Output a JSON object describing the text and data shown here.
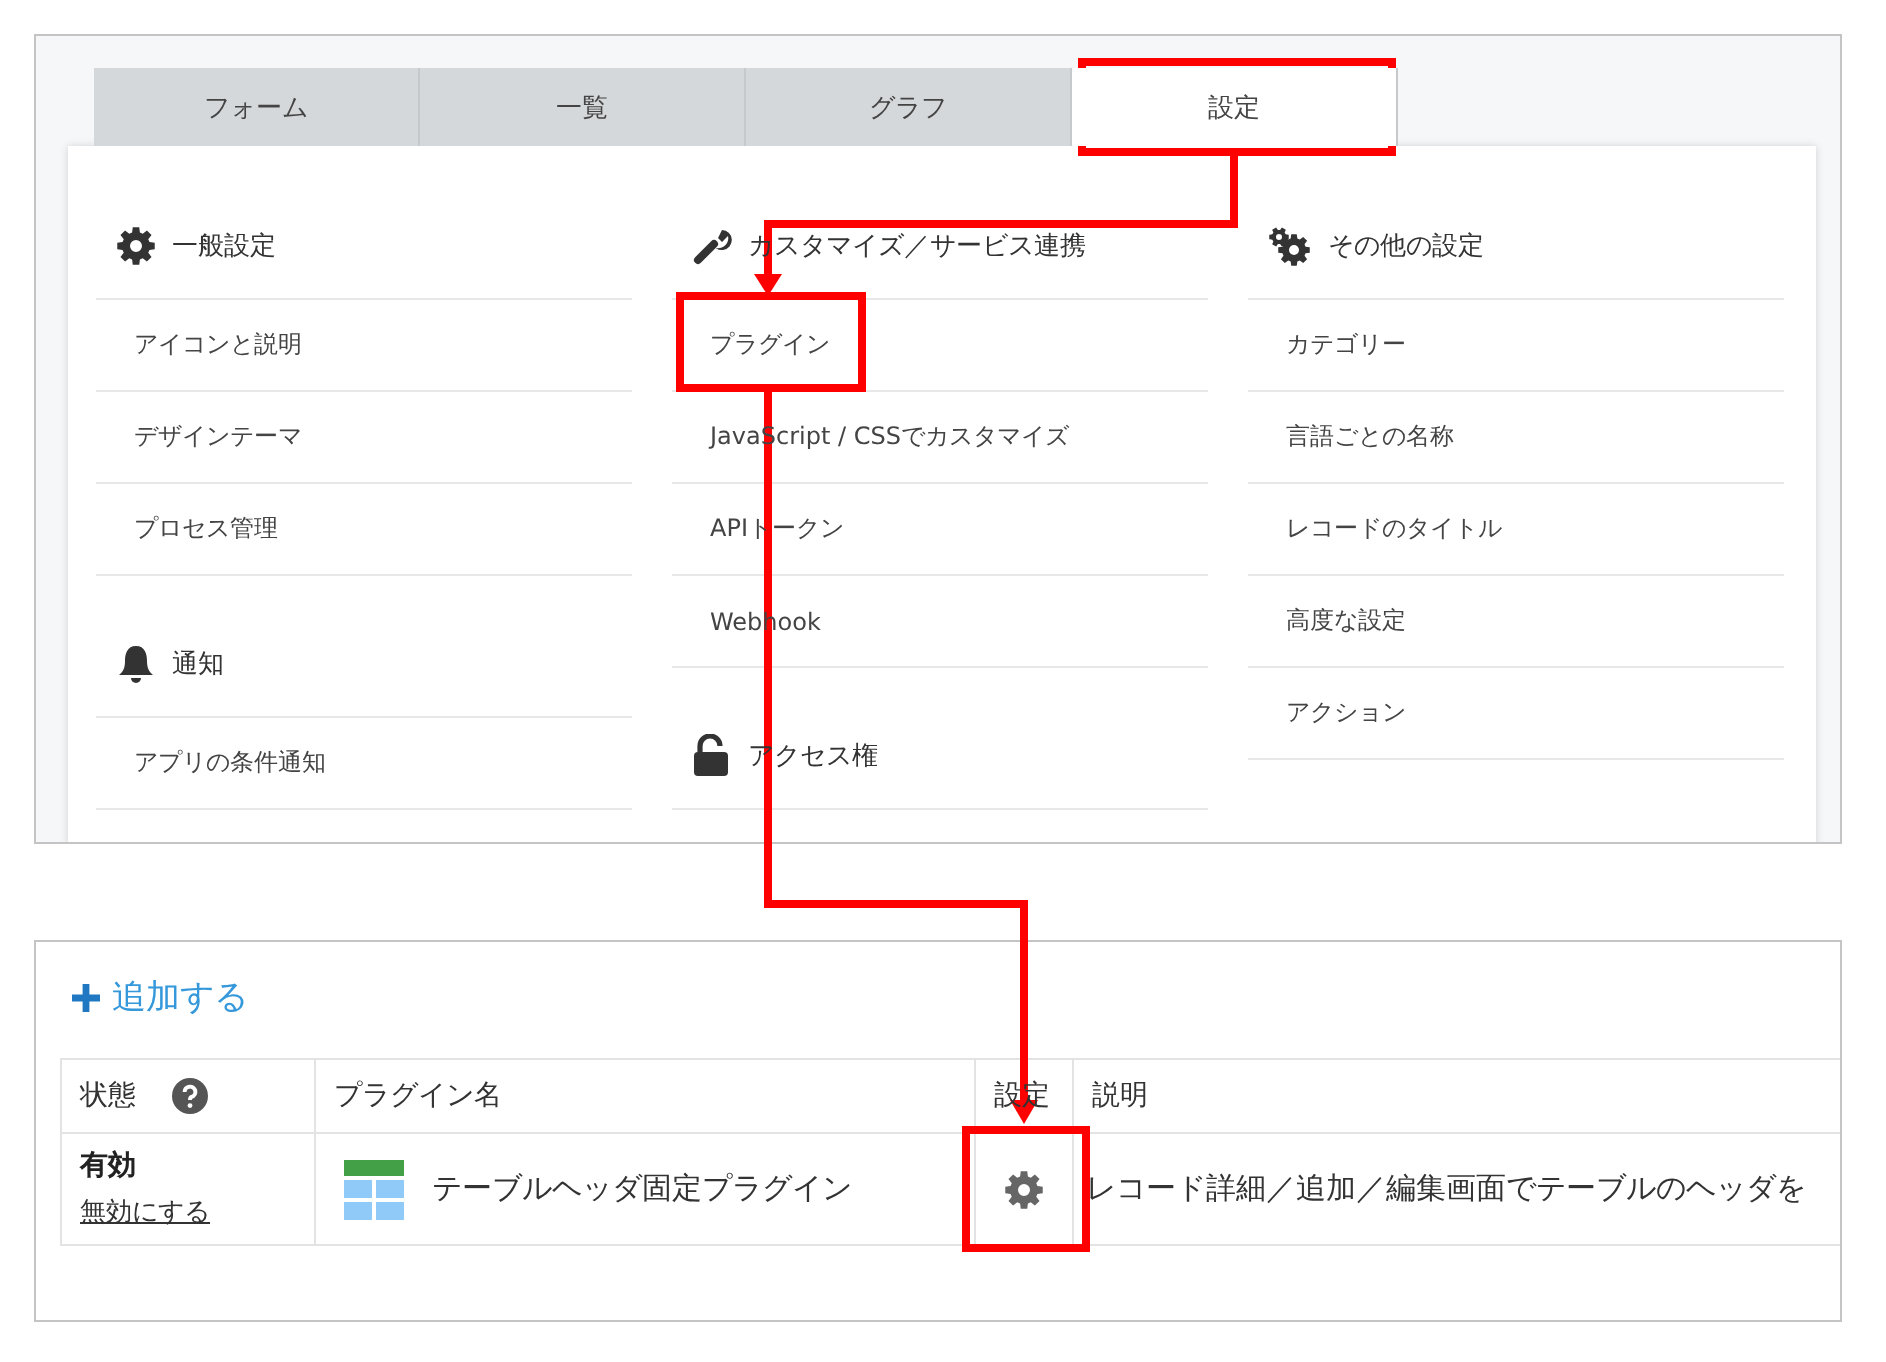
{
  "tabs": [
    {
      "label": "フォーム",
      "selected": false
    },
    {
      "label": "一覧",
      "selected": false
    },
    {
      "label": "グラフ",
      "selected": false
    },
    {
      "label": "設定",
      "selected": true
    }
  ],
  "settings_columns": [
    {
      "sections": [
        {
          "kind": "gear",
          "heading": "一般設定",
          "items": [
            "アイコンと説明",
            "デザインテーマ",
            "プロセス管理"
          ]
        },
        {
          "kind": "bell",
          "heading": "通知",
          "items": [
            "アプリの条件通知"
          ]
        }
      ]
    },
    {
      "sections": [
        {
          "kind": "wrench",
          "heading": "カスタマイズ／サービス連携",
          "items": [
            "プラグイン",
            "JavaScript / CSSでカスタマイズ",
            "APIトークン",
            "Webhook"
          ]
        },
        {
          "kind": "lock",
          "heading": "アクセス権"
        }
      ]
    },
    {
      "sections": [
        {
          "kind": "gears",
          "heading": "その他の設定",
          "items": [
            "カテゴリー",
            "言語ごとの名称",
            "レコードのタイトル",
            "高度な設定",
            "アクション"
          ]
        }
      ]
    }
  ],
  "add_link": "追加する",
  "plugin_table": {
    "columns": [
      {
        "label": "状態",
        "help": true
      },
      {
        "label": "プラグイン名",
        "help": false
      },
      {
        "label": "設定",
        "help": false
      },
      {
        "label": "説明",
        "help": false
      }
    ],
    "rows": [
      {
        "status": "有効",
        "toggle_link": "無効にする",
        "name": "テーブルヘッダ固定プラグイン",
        "description": "レコード詳細／追加／編集画面でテーブルのヘッダを"
      }
    ]
  }
}
